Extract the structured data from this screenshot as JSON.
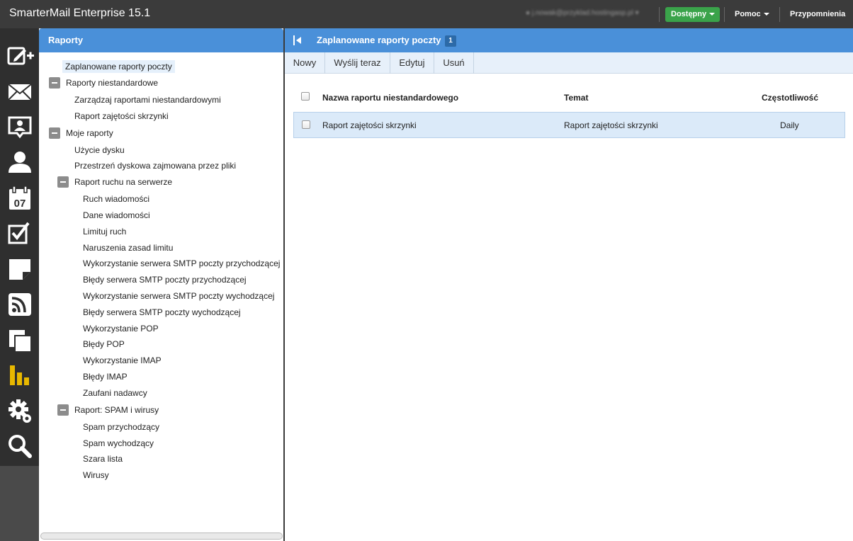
{
  "app": {
    "title": "SmarterMail Enterprise 15.1",
    "user_email": "j.nowak@przyklad.hostingasp.pl",
    "status_label": "Dostępny",
    "help_label": "Pomoc",
    "reminders_label": "Przypomnienia"
  },
  "sidebar_icons": [
    "compose-icon",
    "mail-icon",
    "contacts-icon",
    "person-icon",
    "calendar-icon",
    "tasks-icon",
    "notes-icon",
    "rss-icon",
    "files-icon",
    "reports-icon",
    "settings-icon",
    "search-icon"
  ],
  "calendar_day": "07",
  "tree": {
    "header": "Raporty",
    "items": [
      {
        "label": "Zaplanowane raporty poczty",
        "selected": true
      },
      {
        "label": "Raporty niestandardowe",
        "toggle": "minus"
      },
      {
        "label": "Zarządzaj raportami niestandardowymi"
      },
      {
        "label": "Raport zajętości skrzynki"
      },
      {
        "label": "Moje raporty",
        "toggle": "minus"
      },
      {
        "label": "Użycie dysku"
      },
      {
        "label": "Przestrzeń dyskowa zajmowana przez pliki"
      },
      {
        "label": "Raport ruchu na serwerze",
        "toggle": "minus"
      },
      {
        "label": "Ruch wiadomości"
      },
      {
        "label": "Dane wiadomości"
      },
      {
        "label": "Limituj ruch"
      },
      {
        "label": "Naruszenia zasad limitu"
      },
      {
        "label": "Wykorzystanie serwera SMTP poczty przychodzącej"
      },
      {
        "label": "Błędy serwera SMTP poczty przychodzącej"
      },
      {
        "label": "Wykorzystanie serwera SMTP poczty wychodzącej"
      },
      {
        "label": "Błędy serwera SMTP poczty wychodzącej"
      },
      {
        "label": "Wykorzystanie POP"
      },
      {
        "label": "Błędy POP"
      },
      {
        "label": "Wykorzystanie IMAP"
      },
      {
        "label": "Błędy IMAP"
      },
      {
        "label": "Zaufani nadawcy"
      },
      {
        "label": "Raport: SPAM i wirusy",
        "toggle": "minus"
      },
      {
        "label": "Spam przychodzący"
      },
      {
        "label": "Spam wychodzący"
      },
      {
        "label": "Szara lista"
      },
      {
        "label": "Wirusy"
      }
    ]
  },
  "main": {
    "title": "Zaplanowane raporty poczty",
    "count": "1",
    "toolbar": [
      "Nowy",
      "Wyślij teraz",
      "Edytuj",
      "Usuń"
    ],
    "columns": [
      "Nazwa raportu niestandardowego",
      "Temat",
      "Częstotliwość"
    ],
    "rows": [
      {
        "name": "Raport zajętości skrzynki",
        "subject": "Raport zajętości skrzynki",
        "frequency": "Daily"
      }
    ]
  },
  "colors": {
    "accent_blue": "#4a90d9",
    "status_green": "#3aa34a",
    "topbar": "#3b3b3b",
    "reports_icon": "#e8b800"
  }
}
